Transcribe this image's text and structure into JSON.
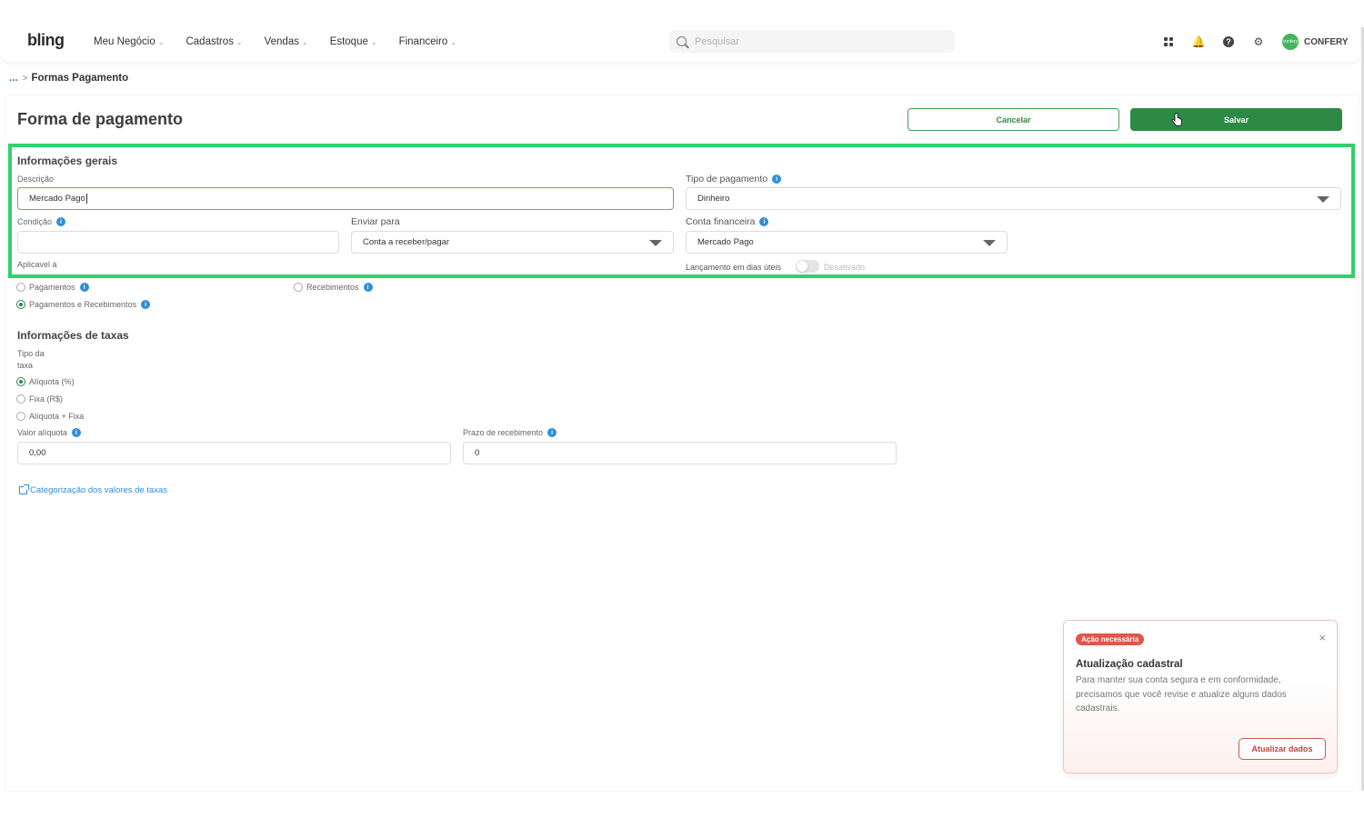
{
  "header": {
    "logo": "bling",
    "nav": [
      {
        "label": "Meu Negócio"
      },
      {
        "label": "Cadastros"
      },
      {
        "label": "Vendas"
      },
      {
        "label": "Estoque"
      },
      {
        "label": "Financeiro"
      }
    ],
    "search_placeholder": "Pesquisar",
    "user_name": "CONFERY",
    "avatar_text": "confery"
  },
  "breadcrumb": {
    "ellipsis": "...",
    "separator": ">",
    "current": "Formas Pagamento"
  },
  "page": {
    "title": "Forma de pagamento",
    "cancel_label": "Cancelar",
    "save_label": "Salvar"
  },
  "general": {
    "title": "Informações gerais",
    "descricao_label": "Descrição",
    "descricao_value": "Mercado Pago",
    "tipo_label": "Tipo de pagamento",
    "tipo_value": "Dinheiro",
    "condicao_label": "Condição",
    "condicao_value": "",
    "enviar_label": "Enviar para",
    "enviar_value": "Conta a receber/pagar",
    "conta_label": "Conta financeira",
    "conta_value": "Mercado Pago",
    "aplicavel_label": "Aplicavel à",
    "dias_uteis_label": "Lançamento em dias úteis",
    "dias_uteis_state": "Desativado",
    "aplicavel_options": [
      {
        "label": "Pagamentos",
        "checked": false
      },
      {
        "label": "Recebimentos",
        "checked": false
      },
      {
        "label": "Pagamentos e Recebimentos",
        "checked": true
      }
    ]
  },
  "taxas": {
    "title": "Informações de taxas",
    "tipo_label_line1": "Tipo da",
    "tipo_label_line2": "taxa",
    "tipo_options": [
      {
        "label": "Alíquota (%)",
        "checked": true
      },
      {
        "label": "Fixa (R$)",
        "checked": false
      },
      {
        "label": "Alíquota + Fixa",
        "checked": false
      }
    ],
    "valor_label": "Valor alíquota",
    "valor_value": "0,00",
    "prazo_label": "Prazo de recebimento",
    "prazo_value": "0",
    "link_label": "Categorização dos valores de taxas"
  },
  "toast": {
    "badge": "Ação necessária",
    "close": "×",
    "title": "Atualização cadastral",
    "body": "Para manter sua conta segura e em conformidade, precisamos que você revise e atualize alguns dados cadastrais.",
    "button": "Atualizar dados"
  },
  "colors": {
    "brand": "#2c8a45",
    "highlight": "#2fd16b",
    "info": "#2f8ed8",
    "alert": "#e2554a"
  }
}
